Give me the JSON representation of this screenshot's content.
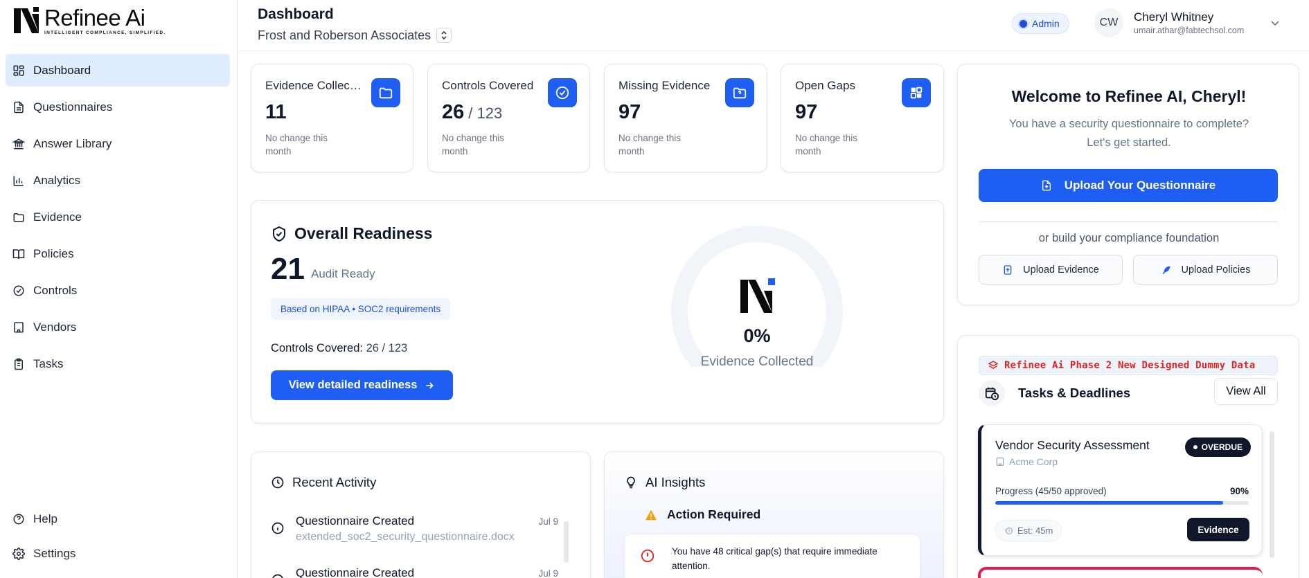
{
  "brand": {
    "name": "Refinee Ai",
    "tagline": "INTELLIGENT COMPLIANCE, SIMPLIFIED."
  },
  "sidebar": {
    "items": [
      {
        "label": "Dashboard",
        "icon": "dashboard-icon",
        "active": true
      },
      {
        "label": "Questionnaires",
        "icon": "document-icon"
      },
      {
        "label": "Answer Library",
        "icon": "library-icon"
      },
      {
        "label": "Analytics",
        "icon": "chart-icon"
      },
      {
        "label": "Evidence",
        "icon": "folder-icon"
      },
      {
        "label": "Policies",
        "icon": "book-icon"
      },
      {
        "label": "Controls",
        "icon": "check-circle-icon"
      },
      {
        "label": "Vendors",
        "icon": "building-icon"
      },
      {
        "label": "Tasks",
        "icon": "clipboard-icon"
      }
    ],
    "bottom": [
      {
        "label": "Help",
        "icon": "help-icon"
      },
      {
        "label": "Settings",
        "icon": "gear-icon"
      }
    ]
  },
  "header": {
    "title": "Dashboard",
    "organization": "Frost and Roberson Associates",
    "role_badge": "Admin",
    "user": {
      "initials": "CW",
      "name": "Cheryl Whitney",
      "email": "umair.athar@fabtechsol.com"
    }
  },
  "stats": [
    {
      "title": "Evidence Collect...",
      "value": "11",
      "denominator": "",
      "note": "No change this month",
      "icon": "folder-icon"
    },
    {
      "title": "Controls Covered",
      "value": "26",
      "denominator": "/ 123",
      "note": "No change this month",
      "icon": "check-circle-icon"
    },
    {
      "title": "Missing Evidence",
      "value": "97",
      "denominator": "",
      "note": "No change this month",
      "icon": "missing-file-icon"
    },
    {
      "title": "Open Gaps",
      "value": "97",
      "denominator": "",
      "note": "No change this month",
      "icon": "puzzle-icon"
    }
  ],
  "readiness": {
    "title": "Overall Readiness",
    "score": "21",
    "score_label": "Audit Ready",
    "requirements": "Based on HIPAA • SOC2 requirements",
    "controls_label": "Controls Covered:",
    "controls_value": "26 / 123",
    "button": "View detailed readiness",
    "gauge_percent": "0%",
    "gauge_fraction": 0,
    "gauge_label": "Evidence Collected",
    "track_color": "#f1f5f9"
  },
  "welcome": {
    "title": "Welcome to Refinee AI, Cheryl!",
    "subtitle": "You have a security questionnaire to complete? Let's get started.",
    "upload_button": "Upload Your Questionnaire",
    "or_text": "or build your compliance foundation",
    "evidence_button": "Upload Evidence",
    "policies_button": "Upload Policies"
  },
  "tasks": {
    "banner": "Refinee Ai Phase 2 New Designed Dummy Data",
    "title": "Tasks & Deadlines",
    "view_all": "View All",
    "items": [
      {
        "title": "Vendor Security Assessment",
        "org": "Acme Corp",
        "status": "OVERDUE",
        "progress_label": "Progress (45/50 approved)",
        "progress_pct": "90%",
        "progress_fraction": 0.9,
        "estimate": "Est: 45m",
        "action": "Evidence"
      }
    ]
  },
  "recent_activity": {
    "title": "Recent Activity",
    "items": [
      {
        "title": "Questionnaire Created",
        "subtitle": "extended_soc2_security_questionnaire.docx",
        "date": "Jul 9"
      },
      {
        "title": "Questionnaire Created",
        "subtitle": "",
        "date": "Jul 9"
      }
    ]
  },
  "ai_insights": {
    "title": "AI Insights",
    "action_title": "Action Required",
    "alert": "You have 48 critical gap(s) that require immediate attention."
  },
  "colors": {
    "primary": "#1e5ef3",
    "dark": "#0f172a",
    "danger": "#dc2626",
    "warning": "#f59e0b"
  }
}
